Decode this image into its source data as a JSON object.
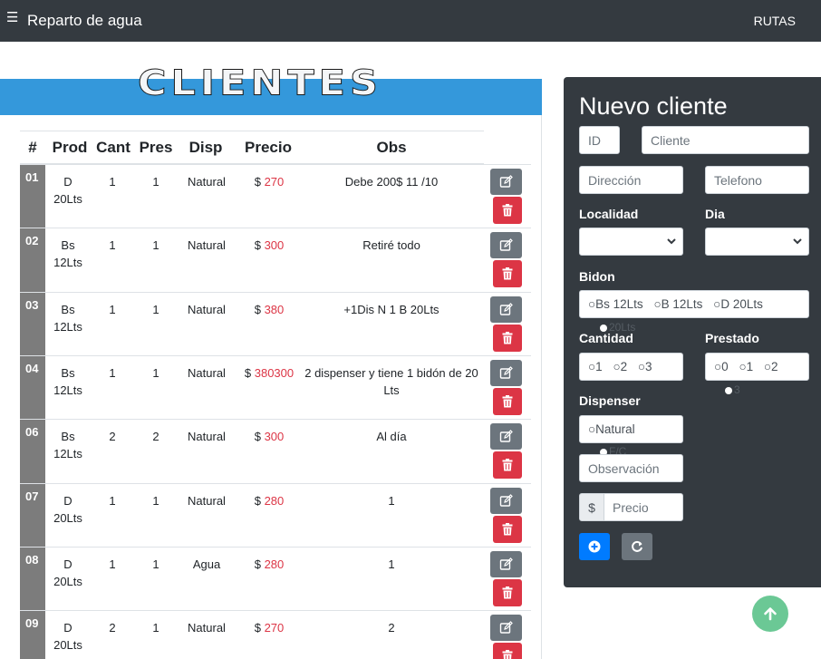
{
  "navbar": {
    "menu_icon": "☰",
    "brand": "Reparto de agua",
    "link": "RUTAS"
  },
  "banner": {
    "title": "CLIENTES",
    "color": "#3498db"
  },
  "table": {
    "headers": [
      "#",
      "Prod",
      "Cant",
      "Pres",
      "Disp",
      "Precio",
      "Obs"
    ],
    "rows": [
      {
        "id": "01",
        "prod_line1": "D",
        "prod_line2": "20Lts",
        "cant": "1",
        "pres": "1",
        "disp": "Natural",
        "currency": "$",
        "precio": "270",
        "obs": "Debe 200$ 11 /10"
      },
      {
        "id": "02",
        "prod_line1": "Bs",
        "prod_line2": "12Lts",
        "cant": "1",
        "pres": "1",
        "disp": "Natural",
        "currency": "$",
        "precio": "300",
        "obs": "Retiré todo"
      },
      {
        "id": "03",
        "prod_line1": "Bs",
        "prod_line2": "12Lts",
        "cant": "1",
        "pres": "1",
        "disp": "Natural",
        "currency": "$",
        "precio": "380",
        "obs": "+1Dis N 1 B 20Lts"
      },
      {
        "id": "04",
        "prod_line1": "Bs",
        "prod_line2": "12Lts",
        "cant": "1",
        "pres": "1",
        "disp": "Natural",
        "currency": "$",
        "precio": "380300",
        "obs": "2 dispenser y tiene 1 bidón de 20 Lts"
      },
      {
        "id": "06",
        "prod_line1": "Bs",
        "prod_line2": "12Lts",
        "cant": "2",
        "pres": "2",
        "disp": "Natural",
        "currency": "$",
        "precio": "300",
        "obs": "Al día"
      },
      {
        "id": "07",
        "prod_line1": "D",
        "prod_line2": "20Lts",
        "cant": "1",
        "pres": "1",
        "disp": "Natural",
        "currency": "$",
        "precio": "280",
        "obs": "1"
      },
      {
        "id": "08",
        "prod_line1": "D",
        "prod_line2": "20Lts",
        "cant": "1",
        "pres": "1",
        "disp": "Agua",
        "currency": "$",
        "precio": "280",
        "obs": "1"
      },
      {
        "id": "09",
        "prod_line1": "D",
        "prod_line2": "20Lts",
        "cant": "2",
        "pres": "1",
        "disp": "Natural",
        "currency": "$",
        "precio": "270",
        "obs": "2"
      }
    ]
  },
  "form": {
    "title": "Nuevo cliente",
    "id_placeholder": "ID",
    "cliente_placeholder": "Cliente",
    "direccion_placeholder": "Dirección",
    "telefono_placeholder": "Telefono",
    "localidad_label": "Localidad",
    "dia_label": "Dia",
    "bidon_label": "Bidon",
    "bidon_options": [
      "Bs 12Lts",
      "B 12Lts",
      "D 20Lts",
      "20Lts"
    ],
    "cantidad_label": "Cantidad",
    "cantidad_options": [
      "1",
      "2",
      "3"
    ],
    "prestado_label": "Prestado",
    "prestado_options": [
      "0",
      "1",
      "2",
      "3"
    ],
    "dispenser_label": "Dispenser",
    "dispenser_options": [
      "Natural",
      "F/C"
    ],
    "observacion_placeholder": "Observación",
    "currency_prefix": "$",
    "precio_placeholder": "Precio"
  },
  "colors": {
    "navbar": "#343a40",
    "danger": "#dc3545",
    "primary": "#007bff",
    "secondary": "#6c757d",
    "success": "#5cc38a"
  }
}
